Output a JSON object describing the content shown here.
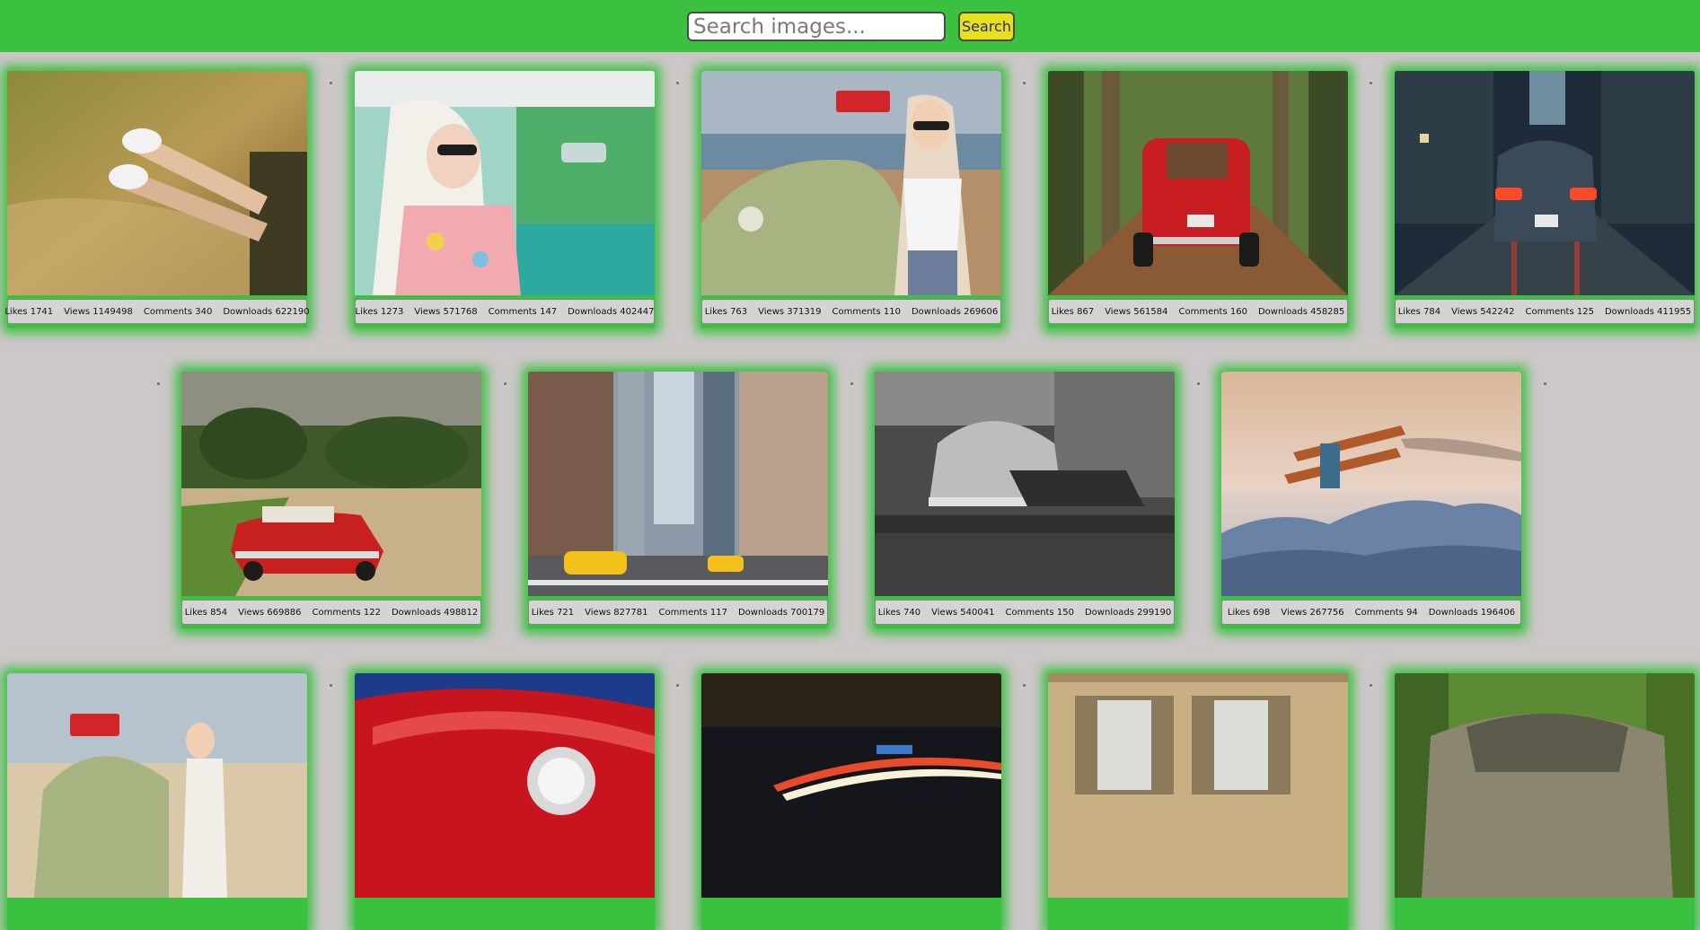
{
  "search": {
    "placeholder": "Search images...",
    "button_label": "Search"
  },
  "labels": {
    "likes": "Likes",
    "views": "Views",
    "comments": "Comments",
    "downloads": "Downloads"
  },
  "colors": {
    "header": "#3ac140",
    "background": "#cdc7c8",
    "search_button": "#e6e11a",
    "card_glow": "#3ac140"
  },
  "images": [
    {
      "likes": "1741",
      "views": "1149498",
      "comments": "340",
      "downloads": "622190"
    },
    {
      "likes": "1273",
      "views": "571768",
      "comments": "147",
      "downloads": "402447"
    },
    {
      "likes": "763",
      "views": "371319",
      "comments": "110",
      "downloads": "269606"
    },
    {
      "likes": "867",
      "views": "561584",
      "comments": "160",
      "downloads": "458285"
    },
    {
      "likes": "784",
      "views": "542242",
      "comments": "125",
      "downloads": "411955"
    },
    {
      "likes": "854",
      "views": "669886",
      "comments": "122",
      "downloads": "498812"
    },
    {
      "likes": "721",
      "views": "827781",
      "comments": "117",
      "downloads": "700179"
    },
    {
      "likes": "740",
      "views": "540041",
      "comments": "150",
      "downloads": "299190"
    },
    {
      "likes": "698",
      "views": "267756",
      "comments": "94",
      "downloads": "196406"
    },
    {},
    {},
    {},
    {},
    {}
  ]
}
